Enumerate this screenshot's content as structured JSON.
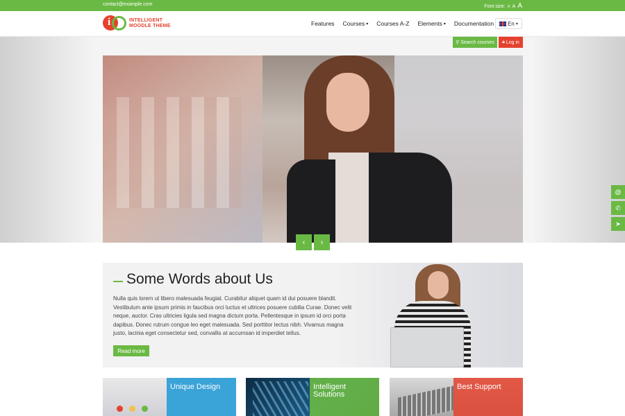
{
  "topbar": {
    "email": "contact@example.com",
    "font_size_label": "Font size:",
    "font_small": "A",
    "font_medium": "A",
    "font_large": "A"
  },
  "logo": {
    "line1": "INTELLIGENT",
    "line2": "MOODLE THEME",
    "mark_letter": "i"
  },
  "nav": {
    "items": [
      {
        "label": "Features",
        "dropdown": false
      },
      {
        "label": "Courses",
        "dropdown": true
      },
      {
        "label": "Courses A-Z",
        "dropdown": false
      },
      {
        "label": "Elements",
        "dropdown": true
      },
      {
        "label": "Documentation",
        "dropdown": false
      }
    ],
    "language": "En"
  },
  "actions": {
    "search_label": "Search courses",
    "login_label": "Log in"
  },
  "slider": {
    "prev_icon": "‹",
    "next_icon": "›"
  },
  "side_icons": [
    "@",
    "✆",
    "➤"
  ],
  "about": {
    "title": "Some Words about Us",
    "body": "Nulla quis lorem ut libero malesuada feugiat. Curabitur aliquet quam id dui posuere blandit. Vestibulum ante ipsum primis in faucibus orci luctus et ultrices posuere cubilia Curae. Donec velit neque, auctor. Cras ultricies ligula sed magna dictum porta. Pellentesque in ipsum id orci porta dapibus. Donec rutrum congue leo eget malesuada. Sed porttitor lectus nibh. Vivamus magna justo, lacinia eget consectetur sed, convallis at accumsan id imperdiet tellus.",
    "read_more": "Read more"
  },
  "cards": [
    {
      "title": "Unique Design"
    },
    {
      "title": "Intelligent Solutions"
    },
    {
      "title": "Best Support"
    }
  ],
  "colors": {
    "green": "#6ab944",
    "red": "#e4422e",
    "blue": "#3aa3d7"
  }
}
